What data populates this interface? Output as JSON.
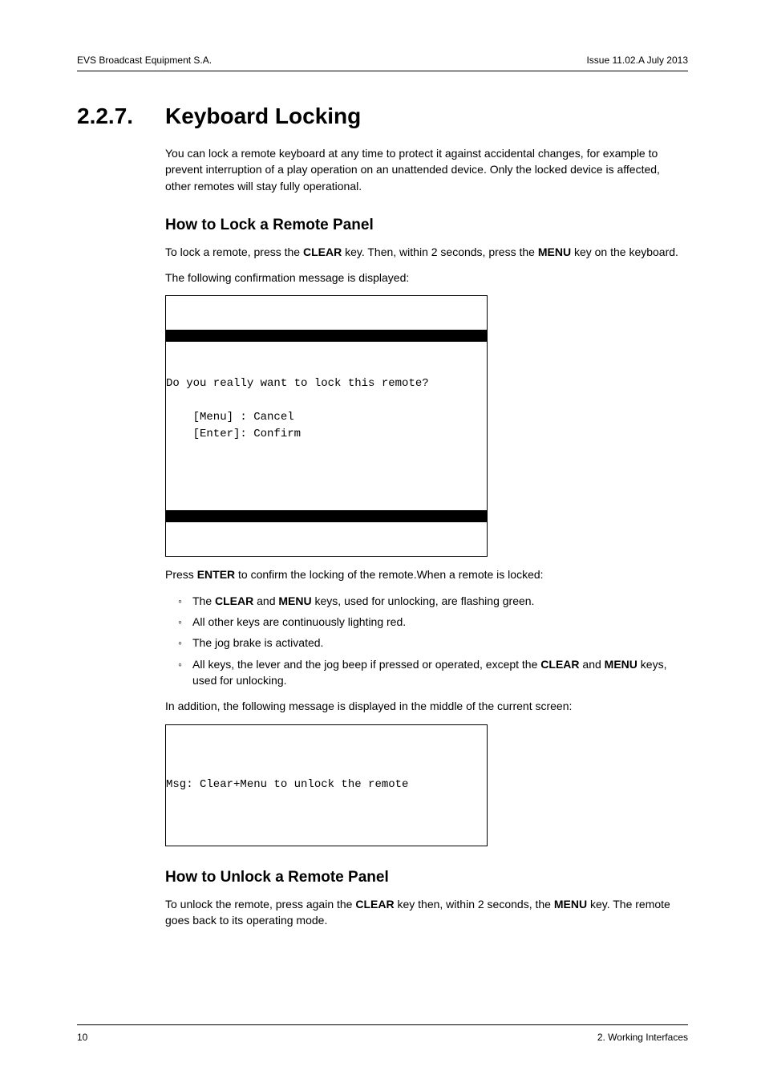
{
  "header": {
    "left": "EVS Broadcast Equipment S.A.",
    "right": "Issue 11.02.A  July 2013"
  },
  "section": {
    "number": "2.2.7.",
    "title": "Keyboard Locking"
  },
  "intro": "You can lock a remote keyboard at any time to protect it against accidental changes, for example to prevent interruption of a play operation on an unattended device. Only the locked device is affected, other remotes will stay fully operational.",
  "lock": {
    "heading": "How to Lock a Remote Panel",
    "p1_a": "To lock a remote, press the ",
    "p1_b": "CLEAR",
    "p1_c": " key. Then, within 2 seconds, press the ",
    "p1_d": "MENU",
    "p1_e": " key on the keyboard.",
    "p2": "The following confirmation message is displayed:",
    "box1_line1": "Do you really want to lock this remote?",
    "box1_line2": "    [Menu] : Cancel",
    "box1_line3": "    [Enter]: Confirm",
    "p3_a": "Press ",
    "p3_b": "ENTER",
    "p3_c": " to confirm the locking of the remote.When a remote is locked:",
    "bullets": {
      "b1_a": "The ",
      "b1_b": "CLEAR",
      "b1_c": " and ",
      "b1_d": "MENU",
      "b1_e": " keys, used for unlocking, are flashing green.",
      "b2": "All other keys are continuously lighting red.",
      "b3": "The jog brake is activated.",
      "b4_a": "All keys, the lever and the jog beep if pressed or operated, except the ",
      "b4_b": "CLEAR",
      "b4_c": " and ",
      "b4_d": "MENU",
      "b4_e": " keys, used for unlocking."
    },
    "p4": "In addition, the following message is displayed in the middle of the current screen:",
    "box2_line": "Msg: Clear+Menu to unlock the remote"
  },
  "unlock": {
    "heading": "How to Unlock a Remote Panel",
    "p1_a": "To unlock the remote, press again the ",
    "p1_b": "CLEAR",
    "p1_c": " key then, within 2 seconds, the ",
    "p1_d": "MENU",
    "p1_e": " key. The remote goes back to its operating mode."
  },
  "footer": {
    "left": "10",
    "right": "2. Working Interfaces"
  }
}
